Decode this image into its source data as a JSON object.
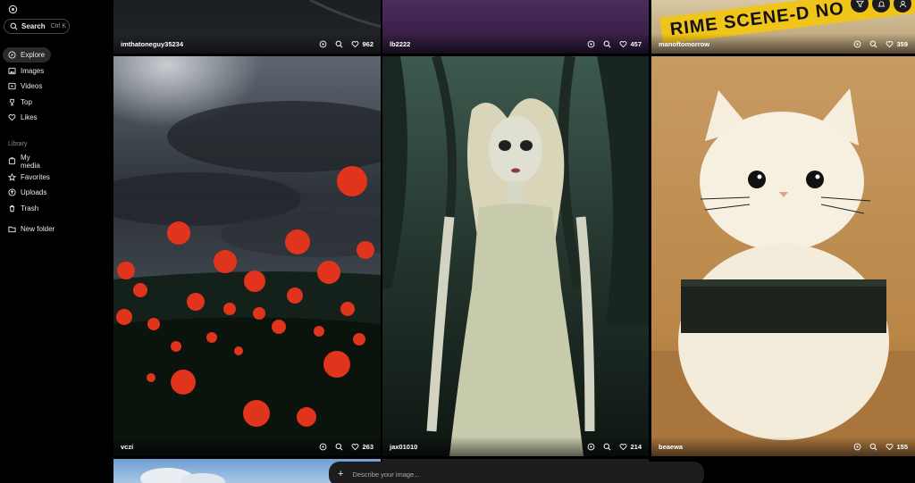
{
  "sidebar": {
    "search": {
      "label": "Search",
      "shortcut": "Ctrl K"
    },
    "nav": [
      {
        "label": "Explore",
        "icon": "compass-icon",
        "active": true
      },
      {
        "label": "Images",
        "icon": "image-icon",
        "active": false
      },
      {
        "label": "Videos",
        "icon": "video-icon",
        "active": false
      },
      {
        "label": "Top",
        "icon": "trophy-icon",
        "active": false
      },
      {
        "label": "Likes",
        "icon": "heart-icon",
        "active": false
      }
    ],
    "library_label": "Library",
    "library": [
      {
        "label": "My media",
        "icon": "media-icon"
      },
      {
        "label": "Favorites",
        "icon": "star-icon"
      },
      {
        "label": "Uploads",
        "icon": "upload-icon"
      },
      {
        "label": "Trash",
        "icon": "trash-icon"
      }
    ],
    "new_folder": "New folder"
  },
  "tiles": [
    {
      "user": "imthatoneguy35234",
      "likes": "962"
    },
    {
      "user": "lb2222",
      "likes": "457"
    },
    {
      "user": "manoftomorrow",
      "likes": "359",
      "tape_text": "RIME SCENE-D NO"
    },
    {
      "user": "vczi",
      "likes": "263"
    },
    {
      "user": "jax01010",
      "likes": "214"
    },
    {
      "user": "beaewa",
      "likes": "155"
    }
  ],
  "prompt": {
    "placeholder": "Describe your image..."
  },
  "colors": {
    "active_bg": "#2a2a2a",
    "background": "#000000",
    "poppy": "#e0341c",
    "tape": "#f0c419"
  }
}
